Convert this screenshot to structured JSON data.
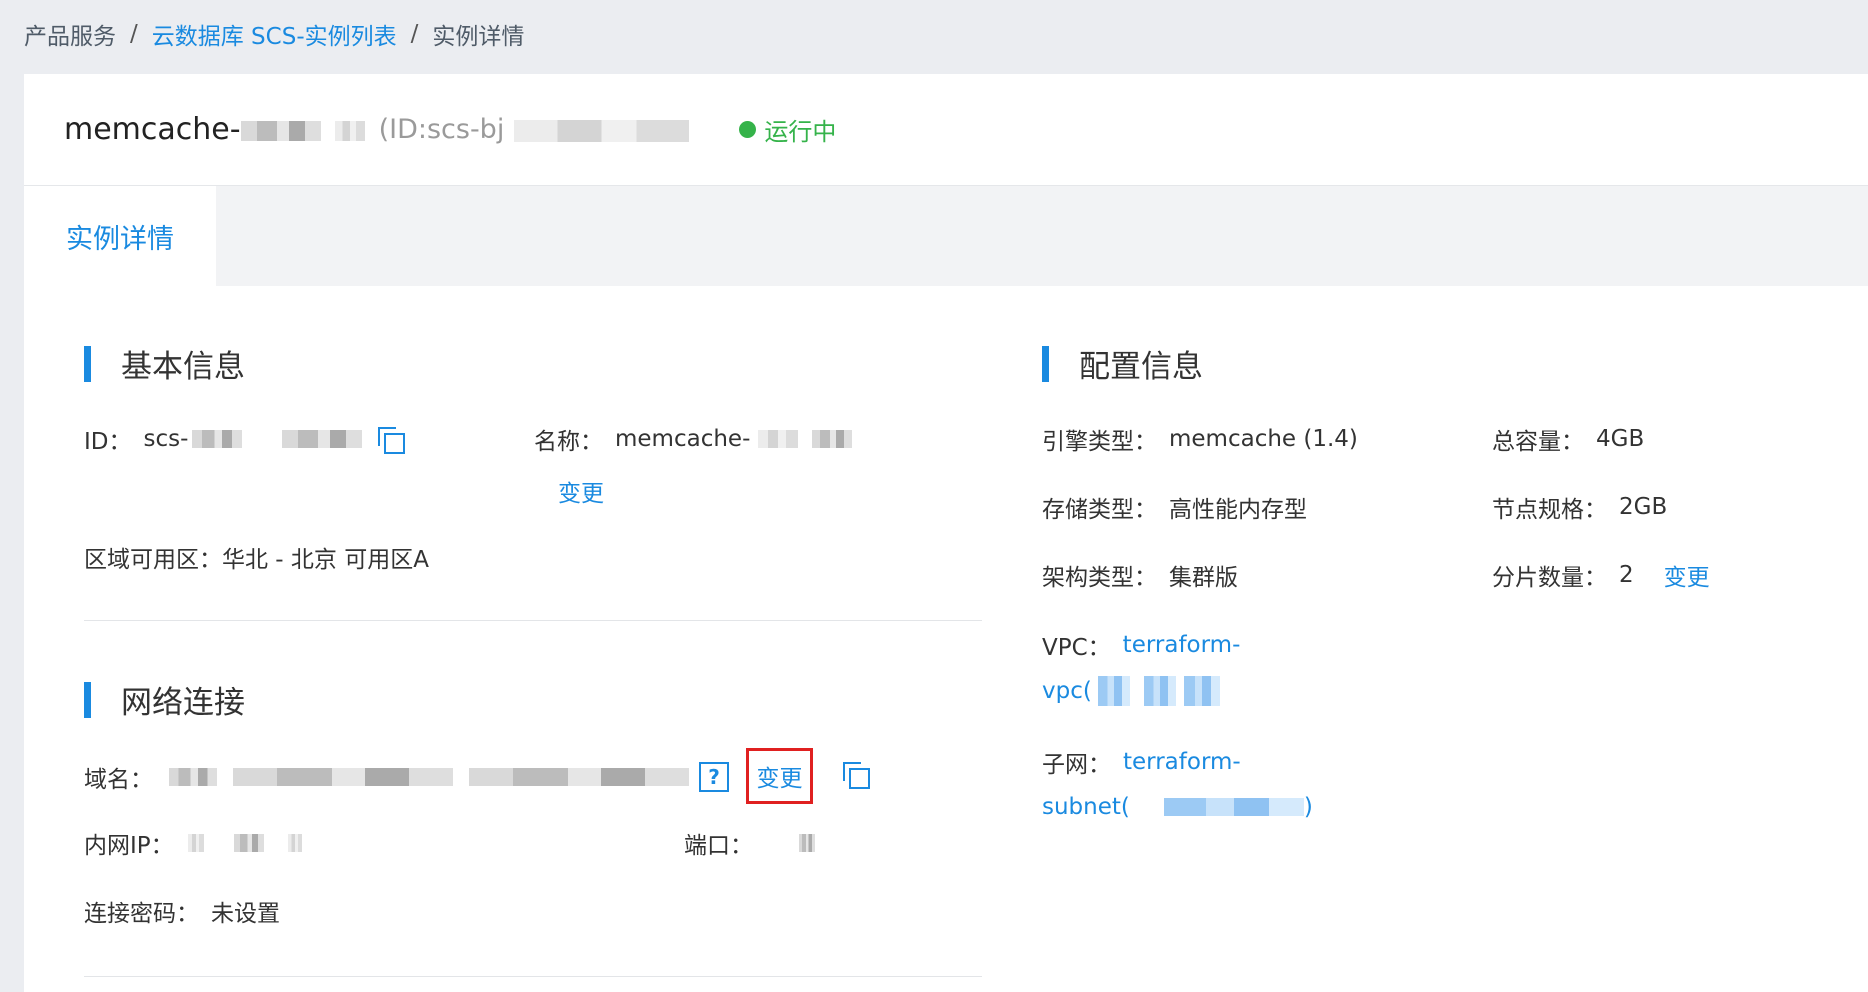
{
  "breadcrumb": {
    "root": "产品服务",
    "separator": "/",
    "list": "云数据库 SCS-实例列表",
    "current": "实例详情"
  },
  "header": {
    "instance_name_prefix": "memcache-",
    "instance_id_prefix": "(ID:scs-bj",
    "status": "运行中"
  },
  "tabs": [
    {
      "label": "实例详情",
      "active": true
    }
  ],
  "basic_info": {
    "title": "基本信息",
    "id_label": "ID：",
    "id_value_prefix": "scs-",
    "name_label": "名称：",
    "name_value_prefix": "memcache-",
    "change_label": "变更",
    "zone_label": "区域可用区：",
    "zone_value": "华北 - 北京 可用区A"
  },
  "network": {
    "title": "网络连接",
    "domain_label": "域名：",
    "help_label": "?",
    "change_label": "变更",
    "private_ip_label": "内网IP：",
    "port_label": "端口：",
    "password_label": "连接密码：",
    "password_value": "未设置"
  },
  "config": {
    "title": "配置信息",
    "engine_label": "引擎类型：",
    "engine_value": "memcache (1.4)",
    "capacity_label": "总容量：",
    "capacity_value": "4GB",
    "storage_label": "存储类型：",
    "storage_value": "高性能内存型",
    "node_spec_label": "节点规格：",
    "node_spec_value": "2GB",
    "arch_label": "架构类型：",
    "arch_value": "集群版",
    "shard_label": "分片数量：",
    "shard_value": "2",
    "change_label": "变更",
    "vpc_label": "VPC：",
    "vpc_value_line1": "terraform-",
    "vpc_value_line2_prefix": "vpc(",
    "subnet_label": "子网：",
    "subnet_value_line1": "terraform-",
    "subnet_value_line2_prefix": "subnet(",
    "subnet_value_suffix": ")"
  },
  "colors": {
    "accent": "#1a8ae0",
    "status_green": "#35b34a",
    "highlight_red": "#e02020",
    "background": "#ebedf1"
  }
}
